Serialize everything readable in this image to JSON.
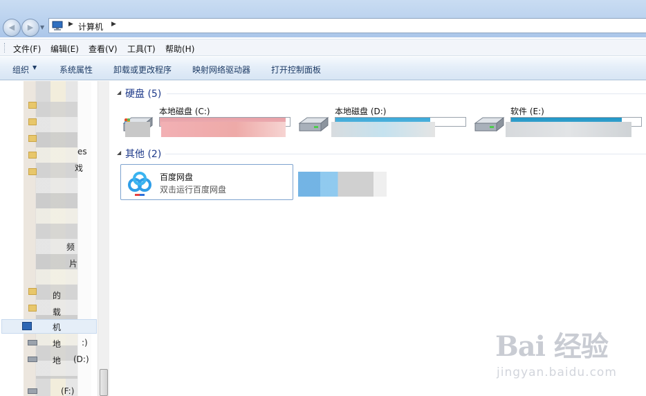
{
  "address": {
    "location": "计算机"
  },
  "menu": [
    "文件(F)",
    "编辑(E)",
    "查看(V)",
    "工具(T)",
    "帮助(H)"
  ],
  "commands": [
    "组织",
    "系统属性",
    "卸载或更改程序",
    "映射网络驱动器",
    "打开控制面板"
  ],
  "nav": {
    "partial_labels": [
      "es",
      "戏",
      "频",
      "片",
      "的",
      "载",
      "机",
      "地",
      ":)",
      "地",
      "(D:)",
      "(F:)"
    ],
    "selected": "机"
  },
  "groups": [
    {
      "label": "硬盘 (5)"
    },
    {
      "label": "其他 (2)"
    }
  ],
  "drives": [
    {
      "name": "本地磁盘 (C:)",
      "fill_fraction": 0.97,
      "bar_color": "#e8a0a6"
    },
    {
      "name": "本地磁盘 (D:)",
      "fill_fraction": 0.73,
      "bar_color": "#3aa8d8"
    },
    {
      "name": "软件 (E:)",
      "fill_fraction": 0.85,
      "bar_color": "#1f95c6"
    }
  ],
  "other": {
    "name": "百度网盘",
    "description": "双击运行百度网盘"
  },
  "watermark": {
    "logo": "Bai 经验",
    "url": "jingyan.baidu.com"
  }
}
